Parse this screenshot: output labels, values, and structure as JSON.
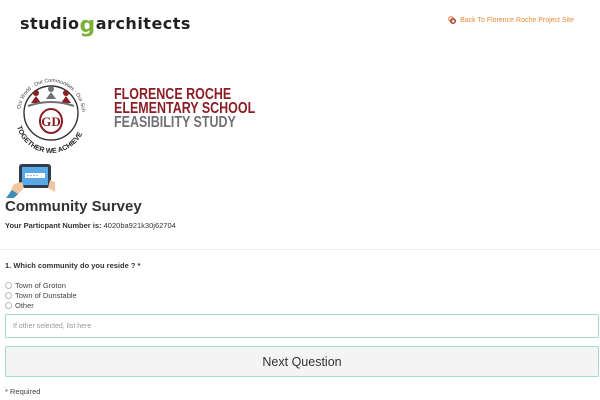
{
  "header": {
    "brand_left": "studio",
    "brand_g": "g",
    "brand_right": "architects",
    "back_link": "Back To Florence Roche Project Site"
  },
  "school": {
    "line1": "FLORENCE ROCHE",
    "line2": "ELEMENTARY SCHOOL",
    "line3": "FEASIBILITY STUDY",
    "logo_top_text": "Our World · Our Communities · Our Schools",
    "logo_bottom_text": "TOGETHER WE ACHIEVE",
    "logo_monogram": "GD"
  },
  "survey": {
    "title": "Community Survey",
    "participant_label": "Your Particpant Number is:",
    "participant_number": "4020ba921k30j62704"
  },
  "question": {
    "text": "1. Which community do you reside ? *",
    "options": [
      "Town of Groton",
      "Town of Dunstable",
      "Other"
    ],
    "other_placeholder": "If other selected, list here"
  },
  "actions": {
    "next_label": "Next Question"
  },
  "footer": {
    "required_note": "* Required"
  },
  "colors": {
    "accent_orange": "#e8893a",
    "brand_green": "#7fb13a",
    "maroon": "#8b1d24",
    "input_border": "#a5dcc7"
  },
  "icons": [
    "back-link-icon",
    "tablet-survey-icon",
    "school-logo"
  ]
}
